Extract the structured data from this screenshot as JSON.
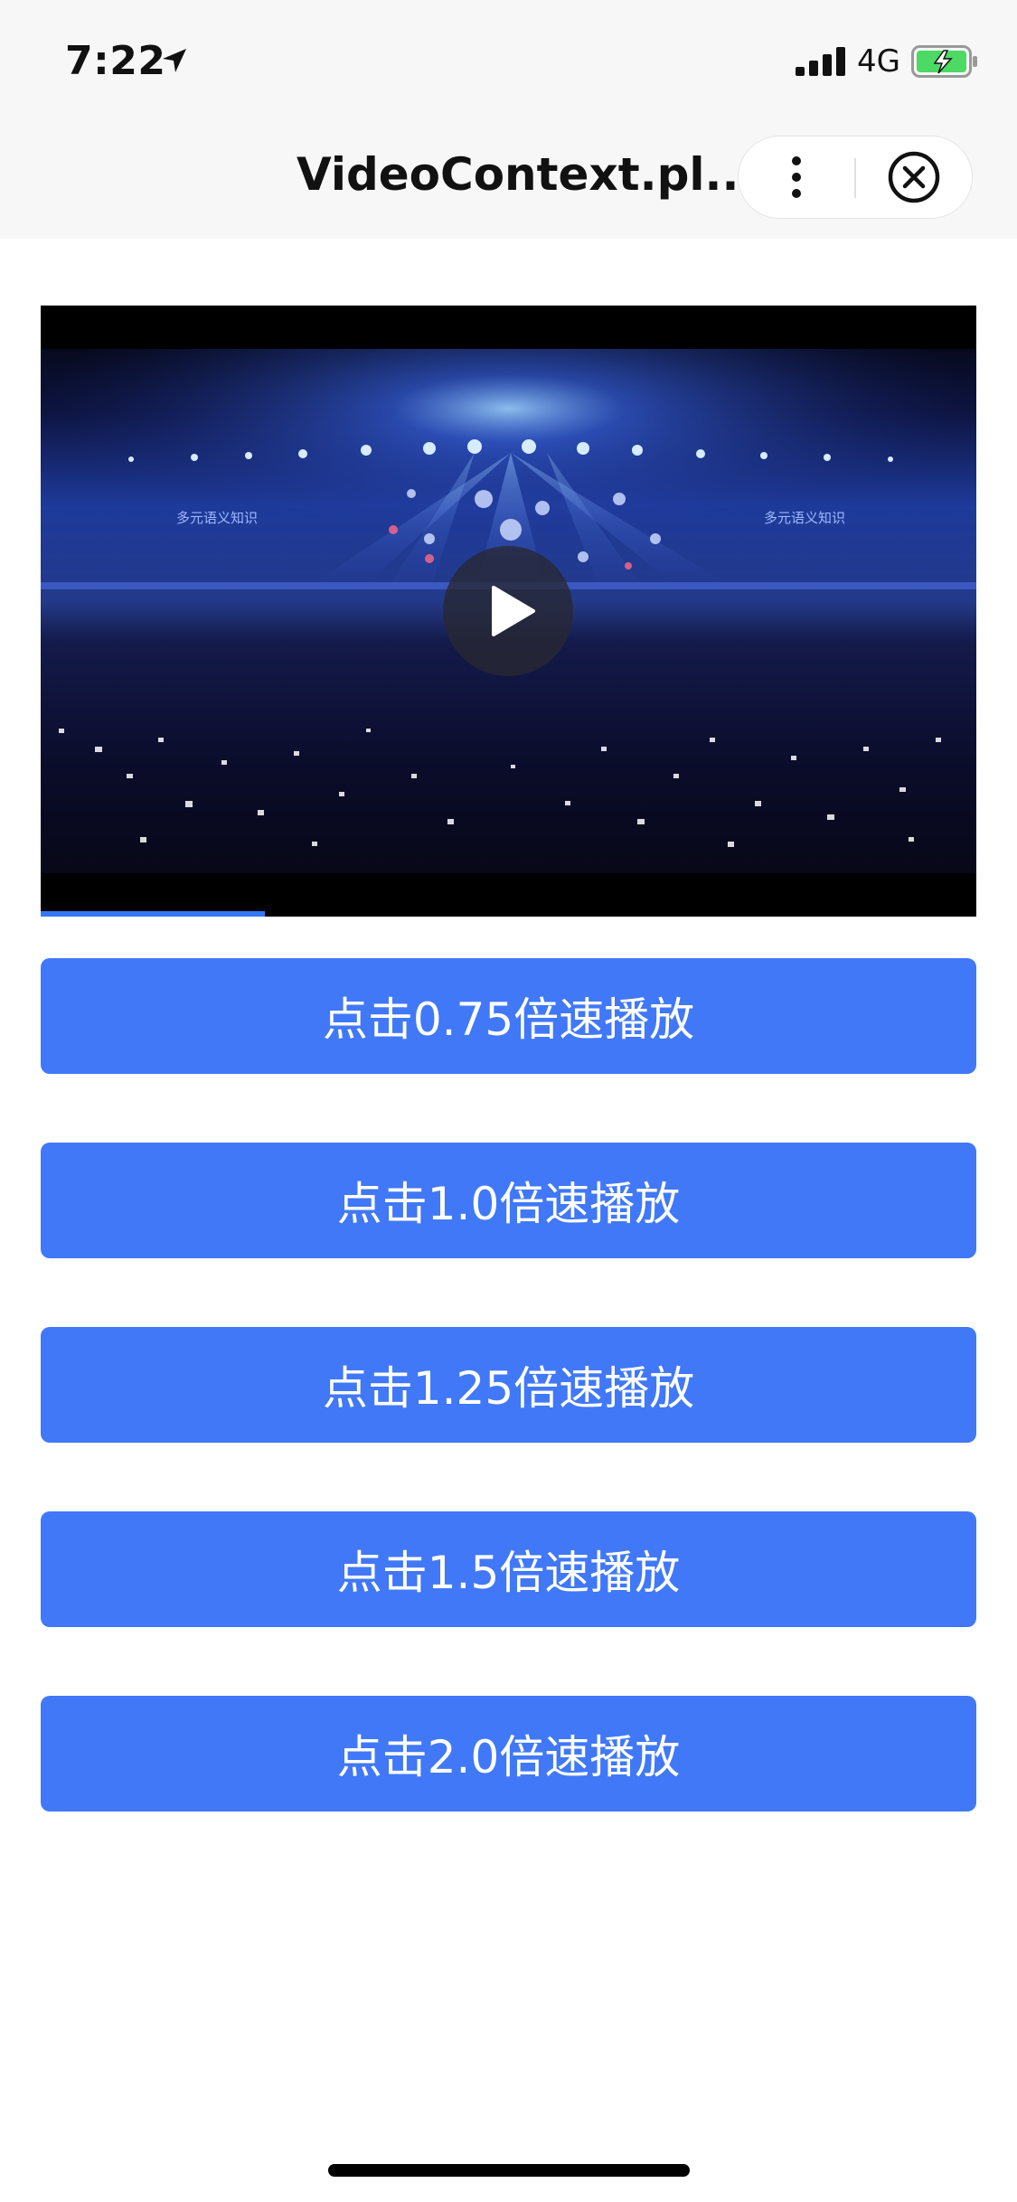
{
  "status_bar": {
    "time": "7:22",
    "network": "4G",
    "icons": [
      "location-arrow-icon",
      "signal-bars-icon",
      "battery-charging-icon"
    ],
    "battery_color": "#4cd964"
  },
  "nav_bar": {
    "title": "VideoContext.pl...",
    "icons": [
      "more-vertical-icon",
      "close-circle-icon"
    ]
  },
  "video": {
    "progress_fraction": 0.24,
    "overlay_text_left": "多元语义知识",
    "overlay_text_right": "多元语义知识",
    "icon": "play-icon"
  },
  "buttons": [
    {
      "label": "点击0.75倍速播放"
    },
    {
      "label": "点击1.0倍速播放"
    },
    {
      "label": "点击1.25倍速播放"
    },
    {
      "label": "点击1.5倍速播放"
    },
    {
      "label": "点击2.0倍速播放"
    }
  ],
  "colors": {
    "button_bg": "#4078f8",
    "progress": "#3478f6"
  }
}
